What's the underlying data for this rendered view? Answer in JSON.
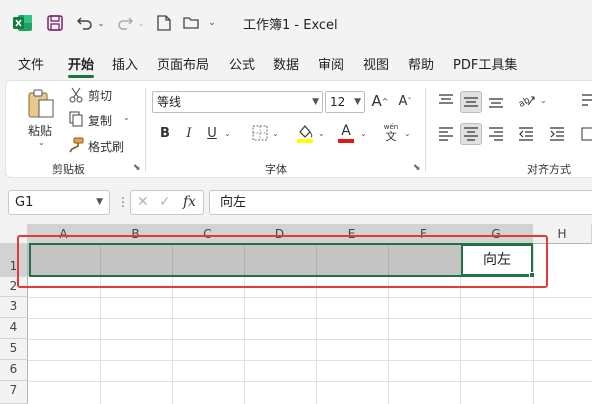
{
  "titlebar": {
    "title": "工作簿1  -  Excel",
    "icons": [
      "excel-logo-icon",
      "save-icon",
      "undo-icon",
      "redo-icon",
      "new-file-icon",
      "open-folder-icon",
      "more-icon"
    ]
  },
  "menu": {
    "items": [
      "文件",
      "开始",
      "插入",
      "页面布局",
      "公式",
      "数据",
      "审阅",
      "视图",
      "帮助",
      "PDF工具集"
    ],
    "active": "开始"
  },
  "ribbon": {
    "clipboard": {
      "paste": "粘贴",
      "cut": "剪切",
      "copy": "复制",
      "format_painter": "格式刷",
      "group_label": "剪贴板"
    },
    "font": {
      "font_name": "等线",
      "font_size": "12",
      "bold": "B",
      "italic": "I",
      "underline": "U",
      "font_color_letter": "A",
      "phonetic_top": "wén",
      "phonetic_bottom": "文",
      "increase_size": "A",
      "decrease_size": "A",
      "group_label": "字体",
      "highlight_color": "#ffff00",
      "font_color": "#e01919"
    },
    "alignment": {
      "group_label": "对齐方式"
    }
  },
  "formula_bar": {
    "name_box": "G1",
    "fx_label": "fx",
    "content": "向左"
  },
  "sheet": {
    "columns": [
      "A",
      "B",
      "C",
      "D",
      "E",
      "F",
      "G",
      "H"
    ],
    "rows": [
      "1",
      "2",
      "3",
      "4",
      "5",
      "6",
      "7"
    ],
    "cell_g1": "向左",
    "accent": "#1f7246",
    "annotation_color": "#e03a3a"
  }
}
